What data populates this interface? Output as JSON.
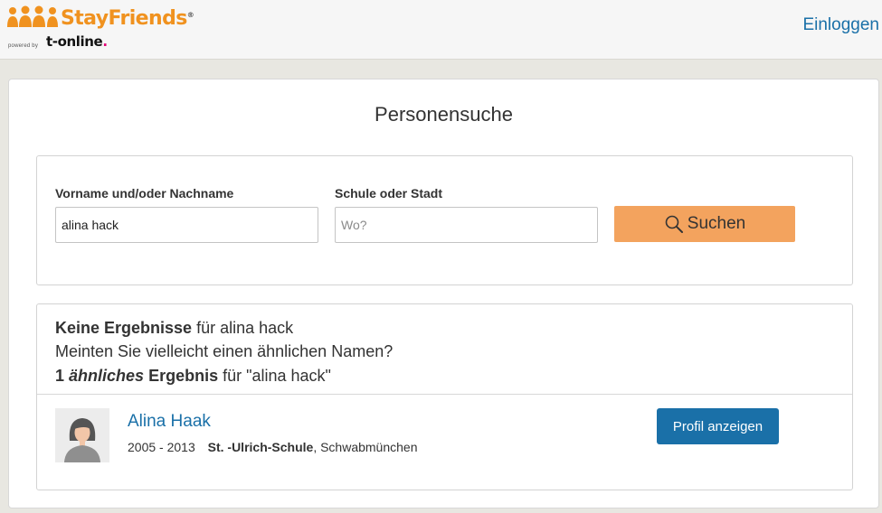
{
  "header": {
    "brand": "StayFriends",
    "brand_mark": "®",
    "powered_by": "powered by",
    "partner": "t-online",
    "partner_dot": ".",
    "login_label": "Einloggen",
    "brand_color": "#f0921f",
    "link_color": "#1a70a8"
  },
  "page": {
    "title": "Personensuche"
  },
  "search": {
    "name_label": "Vorname und/oder Nachname",
    "name_value": "alina hack",
    "location_label": "Schule oder Stadt",
    "location_placeholder": "Wo?",
    "location_value": "",
    "button_label": "Suchen",
    "button_icon": "search-icon",
    "button_color": "#f3a35e"
  },
  "results": {
    "no_results_bold": "Keine Ergebnisse",
    "no_results_rest": " für alina hack",
    "suggestion": "Meinten Sie vielleicht einen ähnlichen Namen?",
    "count": "1",
    "similar_word": "ähnliches",
    "result_word": "Ergebnis",
    "for_query": " für \"alina hack\"",
    "items": [
      {
        "name": "Alina Haak",
        "years": "2005 - 2013",
        "school": "St. -Ulrich-Schule",
        "city": ", Schwabmünchen",
        "avatar_icon": "female-avatar-icon",
        "button_label": "Profil anzeigen"
      }
    ]
  }
}
